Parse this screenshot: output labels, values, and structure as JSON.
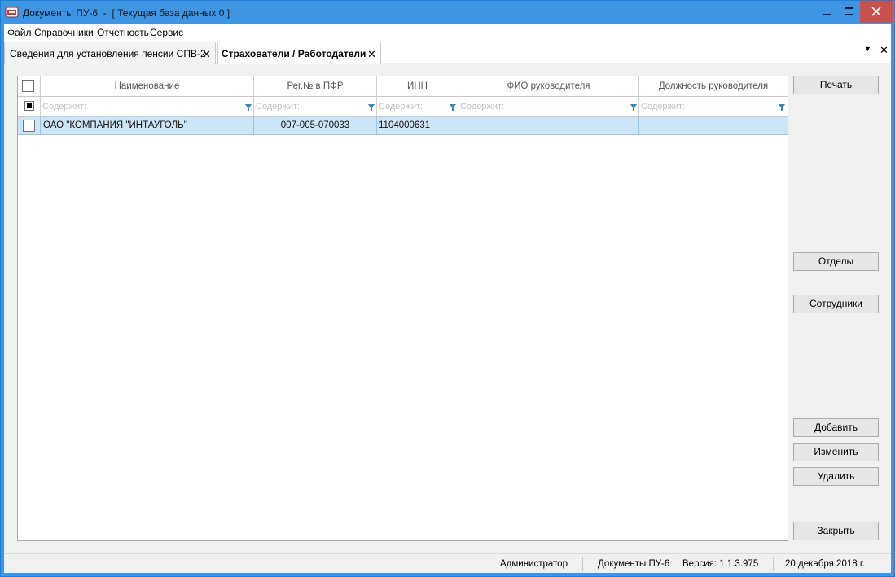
{
  "window": {
    "title": "Документы ПУ-6  -  [ Текущая база данных 0 ]"
  },
  "menu": [
    "Файл",
    "Справочники",
    "Отчетность",
    "Сервис"
  ],
  "tabs": [
    {
      "label": "Сведения для установления пенсии СПВ-2",
      "active": false
    },
    {
      "label": "Страхователи / Работодатели",
      "active": true
    }
  ],
  "grid": {
    "columns": [
      "Наименование",
      "Рег.№ в ПФР",
      "ИНН",
      "ФИО руководителя",
      "Должность руководителя"
    ],
    "filter_placeholder": "Содержит:",
    "rows": [
      {
        "name": "ОАО \"КОМПАНИЯ \"ИНТАУГОЛЬ\"",
        "reg_pfr": "007-005-070033",
        "inn": "1104000631",
        "director_name": "",
        "director_position": ""
      }
    ]
  },
  "buttons": {
    "print": "Печать",
    "departments": "Отделы",
    "employees": "Сотрудники",
    "add": "Добавить",
    "edit": "Изменить",
    "delete": "Удалить",
    "close": "Закрыть"
  },
  "status": {
    "user": "Администратор",
    "app": "Документы ПУ-6",
    "version": "Версия: 1.1.3.975",
    "date": "20 декабря 2018 г."
  },
  "colors": {
    "titlebar": "#3d95e4",
    "close_button": "#c7524f",
    "selected_row": "#cde6f7",
    "filter_icon": "#2e8bb8"
  }
}
